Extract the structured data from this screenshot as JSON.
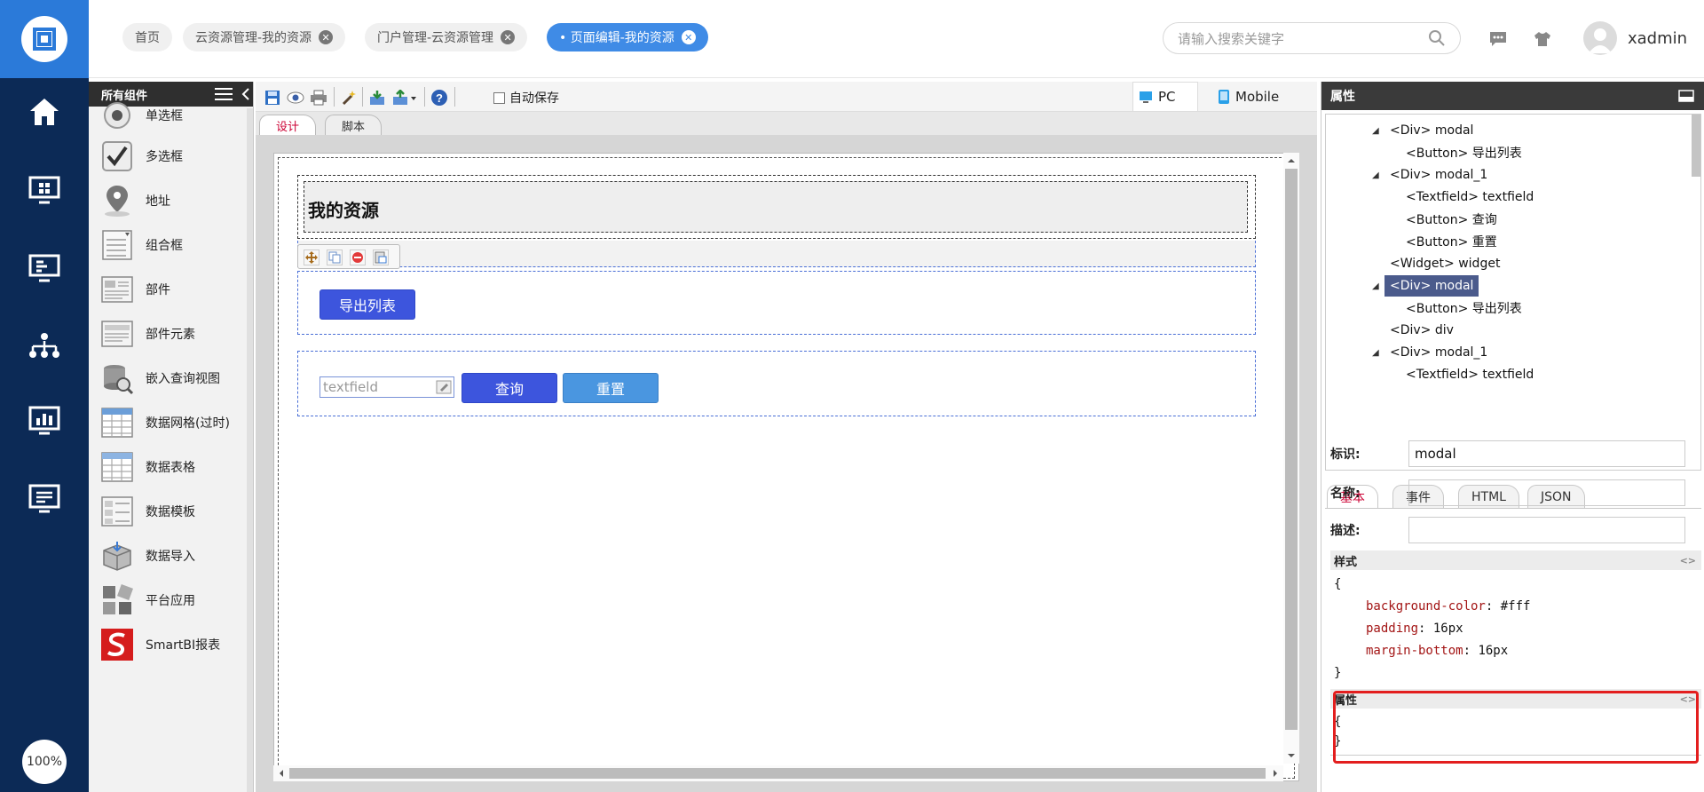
{
  "header": {
    "tabs": [
      {
        "label": "首页",
        "closable": false,
        "active": false
      },
      {
        "label": "云资源管理-我的资源",
        "closable": true,
        "active": false
      },
      {
        "label": "门户管理-云资源管理",
        "closable": true,
        "active": false
      },
      {
        "label": "• 页面编辑-我的资源",
        "closable": true,
        "active": true
      }
    ],
    "search_placeholder": "请输入搜索关键字",
    "username": "xadmin",
    "close_glyph": "✕"
  },
  "leftnav": {
    "zoom": "100%",
    "icons": [
      "home-icon",
      "dashboard-icon",
      "screen-icon",
      "org-icon",
      "chart-icon",
      "monitor-icon"
    ]
  },
  "palette": {
    "title": "所有组件",
    "items": [
      {
        "label": "单选框",
        "icon": "radio-icon"
      },
      {
        "label": "多选框",
        "icon": "checkbox-icon"
      },
      {
        "label": "地址",
        "icon": "location-icon"
      },
      {
        "label": "组合框",
        "icon": "combobox-icon"
      },
      {
        "label": "部件",
        "icon": "widget-icon"
      },
      {
        "label": "部件元素",
        "icon": "widget-element-icon"
      },
      {
        "label": "嵌入查询视图",
        "icon": "query-view-icon"
      },
      {
        "label": "数据网格(过时)",
        "icon": "datagrid-icon"
      },
      {
        "label": "数据表格",
        "icon": "datatable-icon"
      },
      {
        "label": "数据模板",
        "icon": "data-template-icon"
      },
      {
        "label": "数据导入",
        "icon": "data-import-icon"
      },
      {
        "label": "平台应用",
        "icon": "platform-app-icon"
      },
      {
        "label": "SmartBI报表",
        "icon": "smartbi-icon"
      }
    ]
  },
  "toolbar": {
    "autosave_label": "自动保存",
    "device_pc": "PC",
    "device_mobile": "Mobile"
  },
  "editor": {
    "tabs": [
      "设计",
      "脚本"
    ],
    "page_title": "我的资源",
    "export_button": "导出列表",
    "textfield_placeholder": "textfield",
    "query_button": "查询",
    "reset_button": "重置"
  },
  "right_panel": {
    "title": "属性",
    "tree": [
      {
        "label": "<Div> modal",
        "arrow": true,
        "selected": false
      },
      {
        "label": "<Button> 导出列表",
        "arrow": false,
        "selected": false
      },
      {
        "label": "<Div> modal_1",
        "arrow": true,
        "selected": false
      },
      {
        "label": "<Textfield> textfield",
        "arrow": false,
        "selected": false
      },
      {
        "label": "<Button> 查询",
        "arrow": false,
        "selected": false
      },
      {
        "label": "<Button> 重置",
        "arrow": false,
        "selected": false
      },
      {
        "label": "<Widget> widget",
        "arrow": false,
        "selected": false
      },
      {
        "label": "<Div> modal",
        "arrow": true,
        "selected": true
      },
      {
        "label": "<Button> 导出列表",
        "arrow": false,
        "selected": false
      },
      {
        "label": "<Div> div",
        "arrow": false,
        "selected": false
      },
      {
        "label": "<Div> modal_1",
        "arrow": true,
        "selected": false
      },
      {
        "label": "<Textfield> textfield",
        "arrow": false,
        "selected": false
      }
    ],
    "tabs": [
      "基本",
      "事件",
      "HTML",
      "JSON"
    ],
    "fields": [
      {
        "label": "标识:",
        "value": "modal"
      },
      {
        "label": "名称:",
        "value": ""
      },
      {
        "label": "描述:",
        "value": ""
      }
    ],
    "style_section": "样式",
    "style_code": [
      {
        "prop": "background-color",
        "value": "#fff"
      },
      {
        "prop": "padding",
        "value": "16px"
      },
      {
        "prop": "margin-bottom",
        "value": "16px"
      }
    ],
    "attr_section": "属性",
    "brace_open": "{",
    "brace_close": "}",
    "code_toggle": "<>"
  }
}
